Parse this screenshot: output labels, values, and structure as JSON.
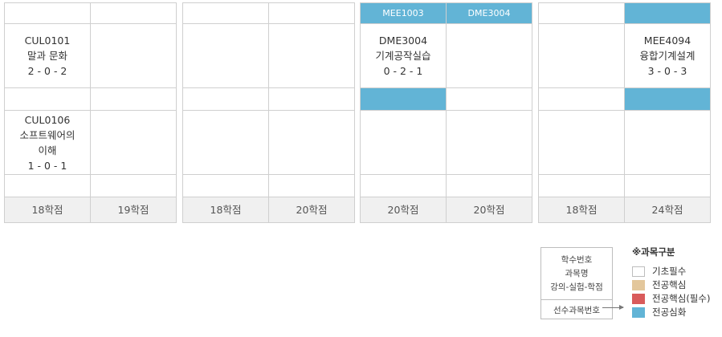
{
  "years": [
    {
      "prereq": [
        "",
        ""
      ],
      "courses1": [
        "CUL0101\n말과 문화\n2 - 0 - 2",
        ""
      ],
      "mid": [
        "",
        ""
      ],
      "courses2": [
        "CUL0106\n소프트웨어의\n이해\n1 - 0 - 1",
        ""
      ],
      "bottom": [
        "",
        ""
      ],
      "credits": [
        "18학점",
        "19학점"
      ]
    },
    {
      "prereq": [
        "",
        ""
      ],
      "courses1": [
        "",
        ""
      ],
      "mid": [
        "",
        ""
      ],
      "courses2": [
        "",
        ""
      ],
      "bottom": [
        "",
        ""
      ],
      "credits": [
        "18학점",
        "20학점"
      ]
    },
    {
      "prereq": [
        "MEE1003",
        "DME3004"
      ],
      "courses1": [
        "DME3004\n기계공작실습\n0 - 2 - 1",
        ""
      ],
      "mid": [
        "",
        ""
      ],
      "courses2": [
        "",
        ""
      ],
      "bottom": [
        "",
        ""
      ],
      "credits": [
        "20학점",
        "20학점"
      ]
    },
    {
      "prereq": [
        "",
        ""
      ],
      "courses1": [
        "",
        "MEE4094\n융합기계설계\n3 - 0 - 3"
      ],
      "mid": [
        "",
        ""
      ],
      "courses2": [
        "",
        ""
      ],
      "bottom": [
        "",
        ""
      ],
      "credits": [
        "18학점",
        "24학점"
      ]
    }
  ],
  "legend": {
    "box_lines": [
      "학수번호",
      "과목명",
      "강의-실험-학점"
    ],
    "prereq_label": "선수과목번호",
    "title": "※과목구분",
    "items": [
      {
        "label": "기초필수",
        "color": "#ffffff"
      },
      {
        "label": "전공핵심",
        "color": "#e3c79c"
      },
      {
        "label": "전공핵심(필수)",
        "color": "#d95b5b"
      },
      {
        "label": "전공심화",
        "color": "#62b4d6"
      }
    ]
  }
}
